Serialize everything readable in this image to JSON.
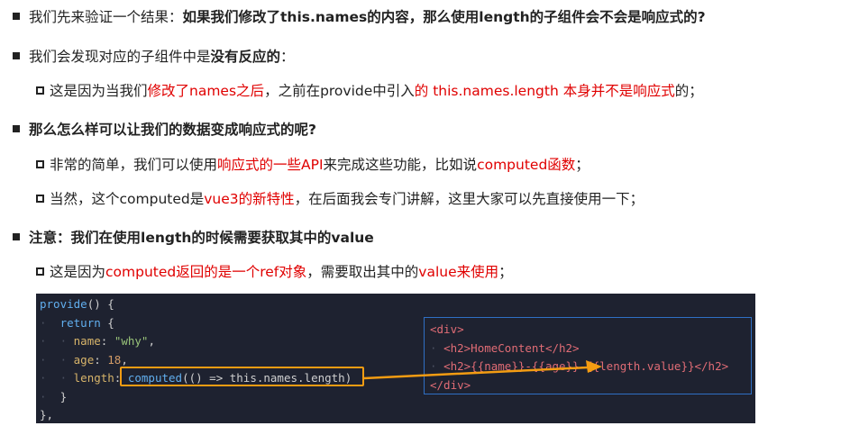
{
  "lines": {
    "l1": {
      "a": "我们先来验证一个结果：",
      "b": "如果我们修改了this.names的内容，那么使用length的子组件会不会是响应式的?"
    },
    "l2": {
      "a": "我们会发现对应的子组件中是",
      "b": "没有反应的",
      "c": "："
    },
    "l3": {
      "a": "这是因为当我们",
      "b": "修改了names之后",
      "c": "，之前在provide中引入",
      "d": "的 this.names.length 本身并不是响应式",
      "e": "的；"
    },
    "l4": {
      "a": "那么怎么样可以让我们的数据变成响应式的呢?"
    },
    "l5": {
      "a": "非常的简单，我们可以使用",
      "b": "响应式的一些API",
      "c": "来完成这些功能，比如说",
      "d": "computed函数",
      "e": "；"
    },
    "l6": {
      "a": "当然，这个computed是",
      "b": "vue3的新特性",
      "c": "，在后面我会专门讲解，这里大家可以先直接使用一下；"
    },
    "l7": {
      "a": "注意：我们在使用length的时候需要获取其中的value"
    },
    "l8": {
      "a": "这是因为",
      "b": "computed返回的是一个ref对象",
      "c": "，需要取出其中的",
      "d": "value来使用",
      "e": "；"
    }
  },
  "code_left": {
    "provide": "provide",
    "parens": "() {",
    "return": "return",
    "brace_open": "{",
    "name_key": "name",
    "name_val": "\"why\"",
    "age_key": "age",
    "age_val": "18",
    "length_key": "length",
    "computed": "computed",
    "computed_rest": "(() => this.names.length)",
    "close1": "}",
    "close2": "},"
  },
  "code_right": {
    "div_open": "<div>",
    "h2_line1": "<h2>HomeContent</h2>",
    "h2_line2": "<h2>{{name}}-{{age}}-{{length.value}}</h2>",
    "div_close": "</div>"
  },
  "colors": {
    "accent_red": "#e00000",
    "code_bg": "#1e2230",
    "highlight_orange": "#f39c12",
    "panel_border": "#2f6fc4"
  }
}
